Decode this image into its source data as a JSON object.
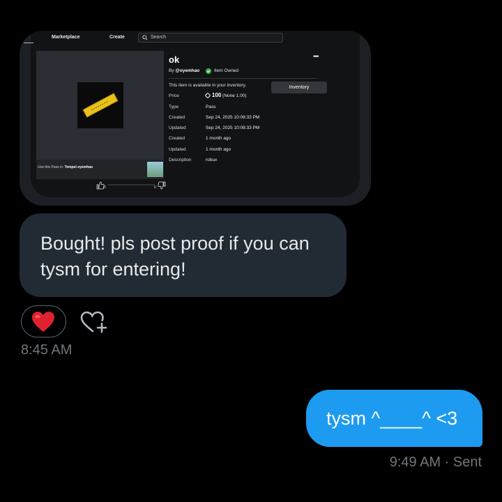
{
  "shared_screenshot": {
    "nav": {
      "marketplace": "Marketplace",
      "create": "Create",
      "search_placeholder": "Search"
    },
    "item": {
      "title": "ok",
      "by_prefix": "By",
      "creator": "@oyemhao",
      "owned_label": "Item Owned",
      "availability": "This item is available in your inventory.",
      "inventory_button": "Inventory",
      "details": [
        {
          "label": "Price",
          "value": "100",
          "value_suffix": "(None 1.00)"
        },
        {
          "label": "Type",
          "value": "Pass"
        },
        {
          "label": "Created",
          "value": "Sep 24, 2025 10:08:33 PM"
        },
        {
          "label": "Updated",
          "value": "Sep 24, 2025 10:08:33 PM"
        },
        {
          "label": "Created",
          "value": "1 month ago"
        },
        {
          "label": "Updated",
          "value": "1 month ago"
        },
        {
          "label": "Description",
          "value": "robux"
        }
      ],
      "use_in_prefix": "Use this Pass in:",
      "use_in_place": "Tempel oyemhao",
      "thumbs_up_count": "0",
      "thumbs_down_count": "0"
    }
  },
  "received_message": {
    "lines": [
      "Bought! pls post proof if you can",
      "tysm for entering!"
    ],
    "reaction": "heart",
    "time": "8:45 AM"
  },
  "sent_message": {
    "text": "tysm ^____^ <3",
    "status": "9:49 AM · Sent"
  },
  "colors": {
    "background": "#000000",
    "received_bubble": "#222b33",
    "sent_bubble": "#1d9bf0",
    "muted_text": "#71767b",
    "owned_badge": "#3ab54a"
  },
  "icons": [
    "search-icon",
    "check-icon",
    "robux-icon",
    "thumbs-up-icon",
    "thumbs-down-icon",
    "more-icon",
    "heart-icon",
    "add-reaction-icon"
  ]
}
